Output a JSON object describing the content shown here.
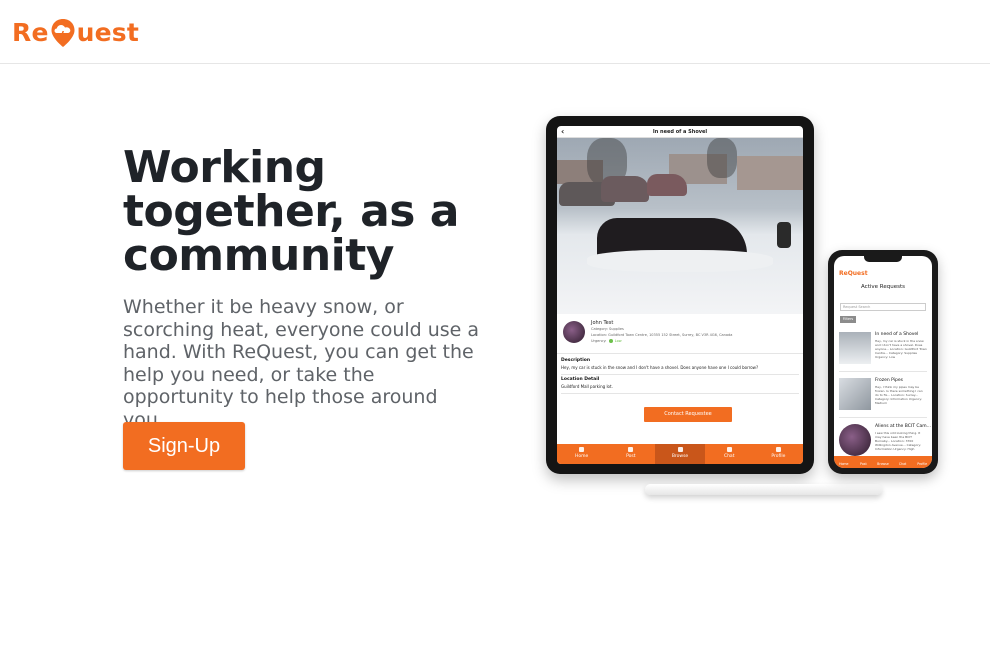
{
  "brand": {
    "logo_before": "Re",
    "logo_after": "uest",
    "accent_color": "#f26d21"
  },
  "hero": {
    "title_line1": "Working",
    "title_line2": "together, as a",
    "title_line3": "community",
    "description": "Whether it be heavy snow, or scorching heat, everyone could use a hand. With ReQuest, you can get the help you need, or take the opportunity to help those around you.",
    "signup_label": "Sign-Up"
  },
  "tablet": {
    "title": "In need of a Shovel",
    "user_name": "John Test",
    "category": "Category: Supplies",
    "location": "Location: Guildford Town Centre, 10355 152 Street, Surrey, BC V3R 4G6, Canada",
    "urgency_label": "Urgency:",
    "urgency_value": "Low",
    "description_heading": "Description",
    "description_text": "Hey, my car is stuck in the snow and I don't have a shovel. Does anyone have one I could borrow?",
    "location_heading": "Location Detail",
    "location_text": "Guildford Mall parking lot.",
    "contact_label": "Contact Requestee",
    "nav": [
      "Home",
      "Post",
      "Browse",
      "Chat",
      "Profile"
    ]
  },
  "phone": {
    "logo": "ReQuest",
    "title": "Active Requests",
    "search_placeholder": "Request Search",
    "filters_label": "Filters",
    "cards": [
      {
        "title": "In need of a Shovel",
        "text": "Hey, my car is stuck in the snow and I don't have a shovel. Does anyone... Location: Guildford Town Centre... Category: Supplies Urgency: Low"
      },
      {
        "title": "Frozen Pipes",
        "text": "Hey, I think my pipes may be frozen. Is there something I can do to fix... Location: Surrey... Category: Information Urgency: Medium"
      },
      {
        "title": "Aliens at the BCIT Cam...",
        "text": "I saw this odd looking thing. It may have been the BCIT Burnaby... Location: 3700 Willingdon Avenue... Category: Information Urgency: High"
      }
    ],
    "nav": [
      "Home",
      "Post",
      "Browse",
      "Chat",
      "Profile"
    ]
  }
}
